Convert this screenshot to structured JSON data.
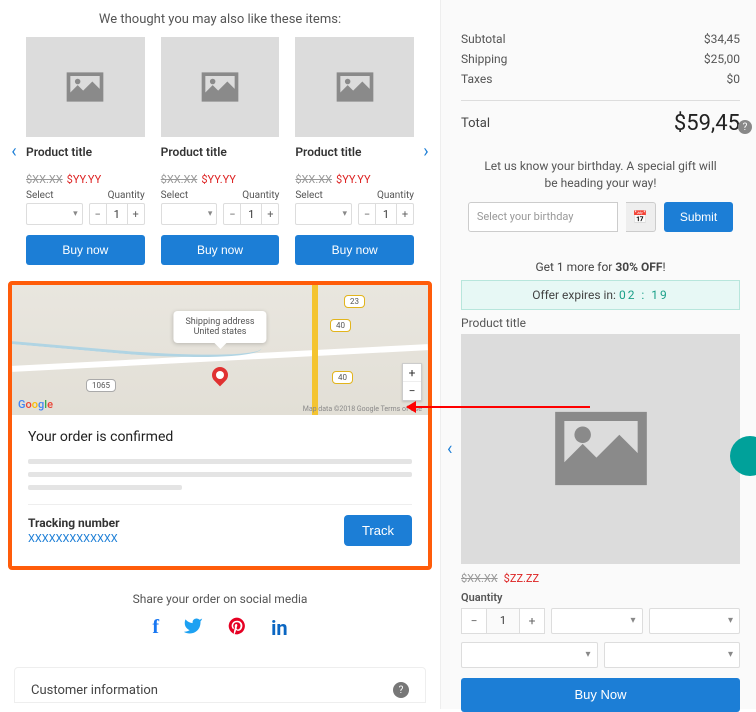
{
  "recs": {
    "heading": "We thought you may also like these items:",
    "items": [
      {
        "title": "Product title",
        "old": "$XX.XX",
        "new": "$YY.YY",
        "select_label": "Select",
        "qty_label": "Quantity",
        "qty": "1",
        "buy": "Buy now"
      },
      {
        "title": "Product title",
        "old": "$XX.XX",
        "new": "$YY.YY",
        "select_label": "Select",
        "qty_label": "Quantity",
        "qty": "1",
        "buy": "Buy now"
      },
      {
        "title": "Product title",
        "old": "$XX.XX",
        "new": "$YY.YY",
        "select_label": "Select",
        "qty_label": "Quantity",
        "qty": "1",
        "buy": "Buy now"
      }
    ]
  },
  "map": {
    "callout_l1": "Shipping address",
    "callout_l2": "United states",
    "attribution": "Map data ©2018 Google   Terms of Use",
    "badges": {
      "b1": "23",
      "b2": "40",
      "b3": "40",
      "p1": "1065"
    }
  },
  "confirm": {
    "title": "Your order is confirmed",
    "tracking_label": "Tracking number",
    "tracking_value": "XXXXXXXXXXXXX",
    "track_btn": "Track"
  },
  "share": {
    "heading": "Share your order on social media",
    "linkedin": "in"
  },
  "customer_info": {
    "label": "Customer information"
  },
  "summary": {
    "subtotal_label": "Subtotal",
    "subtotal": "$34,45",
    "shipping_label": "Shipping",
    "shipping": "$25,00",
    "taxes_label": "Taxes",
    "taxes": "$0",
    "total_label": "Total",
    "total": "$59,45"
  },
  "birthday": {
    "text": "Let us know your birthday. A special gift will be heading your way!",
    "placeholder": "Select your birthday",
    "submit": "Submit"
  },
  "offer": {
    "line_pre": "Get 1 more for ",
    "line_bold": "30% OFF",
    "line_post": "!",
    "expires_label": "Offer expires in: ",
    "timer": "02 : 19"
  },
  "deal": {
    "title": "Product title",
    "old": "$XX.XX",
    "new": "$ZZ.ZZ",
    "qty_label": "Quantity",
    "qty": "1",
    "buy": "Buy Now"
  }
}
